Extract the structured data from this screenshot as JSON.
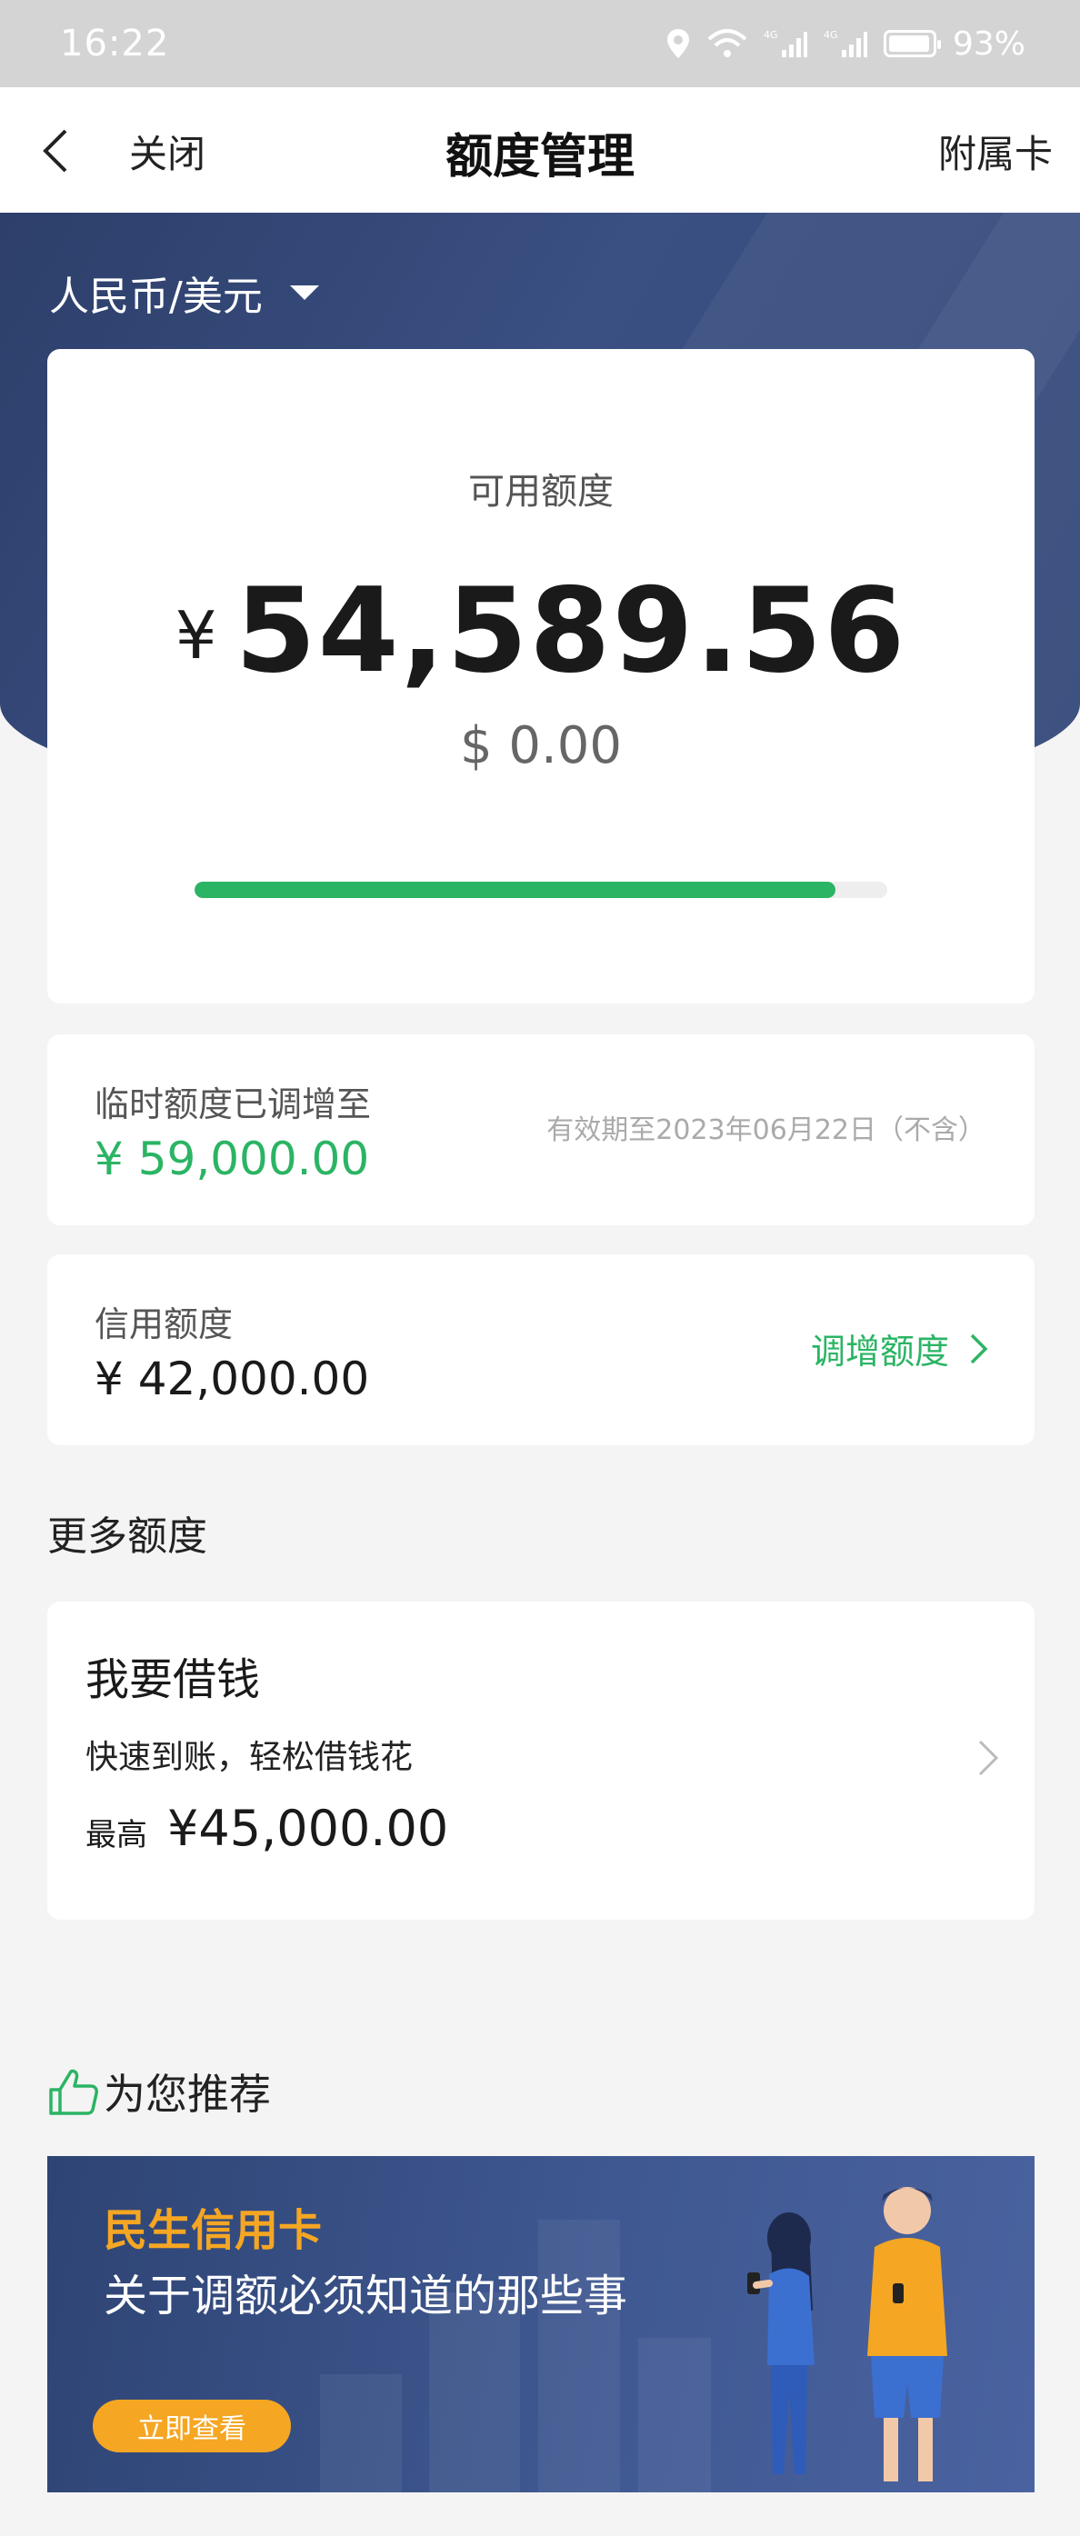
{
  "status_bar": {
    "time": "16:22",
    "battery": "93%"
  },
  "nav": {
    "close_label": "关闭",
    "title": "额度管理",
    "right_label": "附属卡"
  },
  "currency": {
    "selected": "人民币/美元"
  },
  "available": {
    "label": "可用额度",
    "currency_symbol": "¥",
    "amount": "54,589.56",
    "usd": "$ 0.00",
    "progress_percent": 92.5
  },
  "temporary": {
    "label": "临时额度已调增至",
    "amount": "¥ 59,000.00",
    "expiry": "有效期至2023年06月22日（不含）"
  },
  "credit": {
    "label": "信用额度",
    "amount": "¥ 42,000.00",
    "increase_label": "调增额度"
  },
  "more": {
    "title": "更多额度"
  },
  "loan": {
    "title": "我要借钱",
    "subtitle": "快速到账，轻松借钱花",
    "max_label": "最高",
    "max_amount": "¥45,000.00"
  },
  "recommend": {
    "title": "为您推荐",
    "icon": "thumbs-up-icon"
  },
  "banner": {
    "brand": "民生信用卡",
    "headline": "关于调额必须知道的那些事",
    "button_label": "立即查看"
  },
  "colors": {
    "accent_green": "#2bb464",
    "hero_blue": "#34497a",
    "banner_orange": "#f5a623"
  }
}
